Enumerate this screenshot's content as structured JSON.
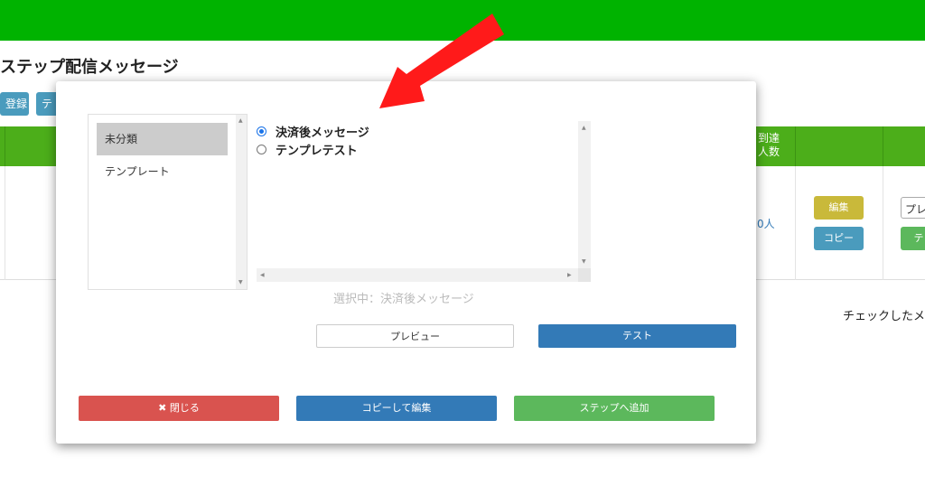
{
  "background": {
    "page_title": "ステップ配信メッセージ",
    "buttons": [
      "登録",
      "テ"
    ],
    "table_headers": {
      "reach": "到達\n人数"
    },
    "row": {
      "count": "0人",
      "edit": "編集",
      "copy": "コピー",
      "select_value": "プレ",
      "green_button": "テ"
    },
    "note": "チェックしたメ"
  },
  "modal": {
    "categories": [
      {
        "label": "未分類",
        "selected": true
      },
      {
        "label": "テンプレート",
        "selected": false
      }
    ],
    "messages": [
      {
        "label": "決済後メッセージ",
        "checked": true
      },
      {
        "label": "テンプレテスト",
        "checked": false
      }
    ],
    "selected_text": "選択中：決済後メッセージ",
    "preview_label": "プレビュー",
    "test_label": "テスト",
    "close_label": "閉じる",
    "close_icon": "✖",
    "copy_edit_label": "コピーして編集",
    "add_step_label": "ステップへ追加"
  },
  "colors": {
    "header_green": "#00b300",
    "table_header_green": "#4cae1a",
    "annotation_arrow": "#ff1a1a",
    "primary_blue": "#337ab7",
    "danger_red": "#d9534f",
    "success_green": "#5cb85c"
  }
}
